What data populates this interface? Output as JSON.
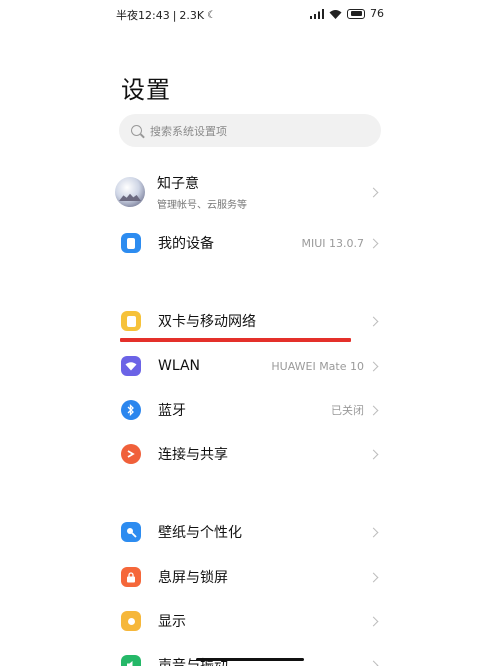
{
  "status_bar": {
    "time": "半夜12:43",
    "speed": "2.3K",
    "battery": "76"
  },
  "page": {
    "title": "设置"
  },
  "search": {
    "placeholder": "搜索系统设置项"
  },
  "profile": {
    "name": "知子意",
    "subtitle": "管理帐号、云服务等"
  },
  "rows": [
    {
      "label": "我的设备",
      "value": "MIUI 13.0.7",
      "icon": "device-icon",
      "color": "#2d8cf0"
    },
    {
      "label": "双卡与移动网络",
      "value": "",
      "icon": "sim-card-icon",
      "color": "#f6c23a"
    },
    {
      "label": "WLAN",
      "value": "HUAWEI Mate 10",
      "icon": "wifi-icon",
      "color": "#6b63e6"
    },
    {
      "label": "蓝牙",
      "value": "已关闭",
      "icon": "bluetooth-icon",
      "color": "#2b86ee"
    },
    {
      "label": "连接与共享",
      "value": "",
      "icon": "share-icon",
      "color": "#f0603a"
    },
    {
      "label": "壁纸与个性化",
      "value": "",
      "icon": "wallpaper-icon",
      "color": "#2d8cf0"
    },
    {
      "label": "息屏与锁屏",
      "value": "",
      "icon": "lock-icon",
      "color": "#f5673a"
    },
    {
      "label": "显示",
      "value": "",
      "icon": "display-icon",
      "color": "#f6b73a"
    },
    {
      "label": "声音与振动",
      "value": "",
      "icon": "sound-icon",
      "color": "#25b868"
    }
  ]
}
